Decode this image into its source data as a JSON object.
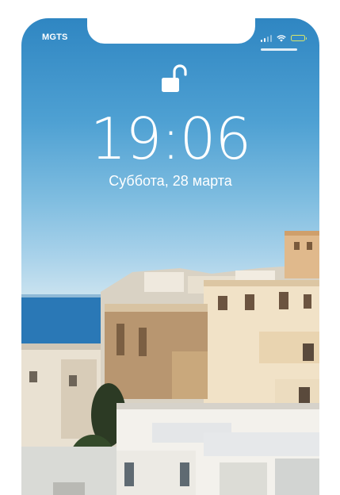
{
  "status_bar": {
    "carrier": "MGTS",
    "signal_bars": 4,
    "signal_bars_filled": 2,
    "wifi_icon": "wifi-icon",
    "battery_icon": "battery-icon",
    "battery_color": "#d8e66a"
  },
  "lock_screen": {
    "lock_icon": "unlocked-padlock-icon",
    "time": "19:06",
    "date": "Суббота, 28 марта"
  },
  "wallpaper": {
    "subject": "coastal-village-photo",
    "sky_color": "#4fa1d3",
    "sea_color": "#2a78b6"
  }
}
